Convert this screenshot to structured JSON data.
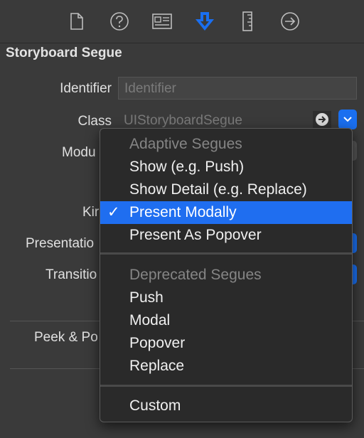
{
  "toolbar": {
    "icons": [
      "file-icon",
      "help-icon",
      "identity-icon",
      "attributes-icon",
      "size-icon",
      "connections-icon"
    ],
    "active_color": "#1a6ff0"
  },
  "section": {
    "title": "Storyboard Segue"
  },
  "fields": {
    "identifier_label": "Identifier",
    "identifier_placeholder": "Identifier",
    "class_label": "Class",
    "class_value": "UIStoryboardSegue",
    "module_label": "Modu",
    "kind_label": "Kir",
    "presentation_label": "Presentatio",
    "transition_label": "Transitio",
    "peek_label": "Peek & Po"
  },
  "menu": {
    "header_adaptive": "Adaptive Segues",
    "show": "Show (e.g. Push)",
    "show_detail": "Show Detail (e.g. Replace)",
    "present_modally": "Present Modally",
    "present_popover": "Present As Popover",
    "header_deprecated": "Deprecated Segues",
    "push": "Push",
    "modal": "Modal",
    "popover": "Popover",
    "replace": "Replace",
    "custom": "Custom",
    "checkmark": "✓",
    "selected_color": "#1f6ef0"
  }
}
